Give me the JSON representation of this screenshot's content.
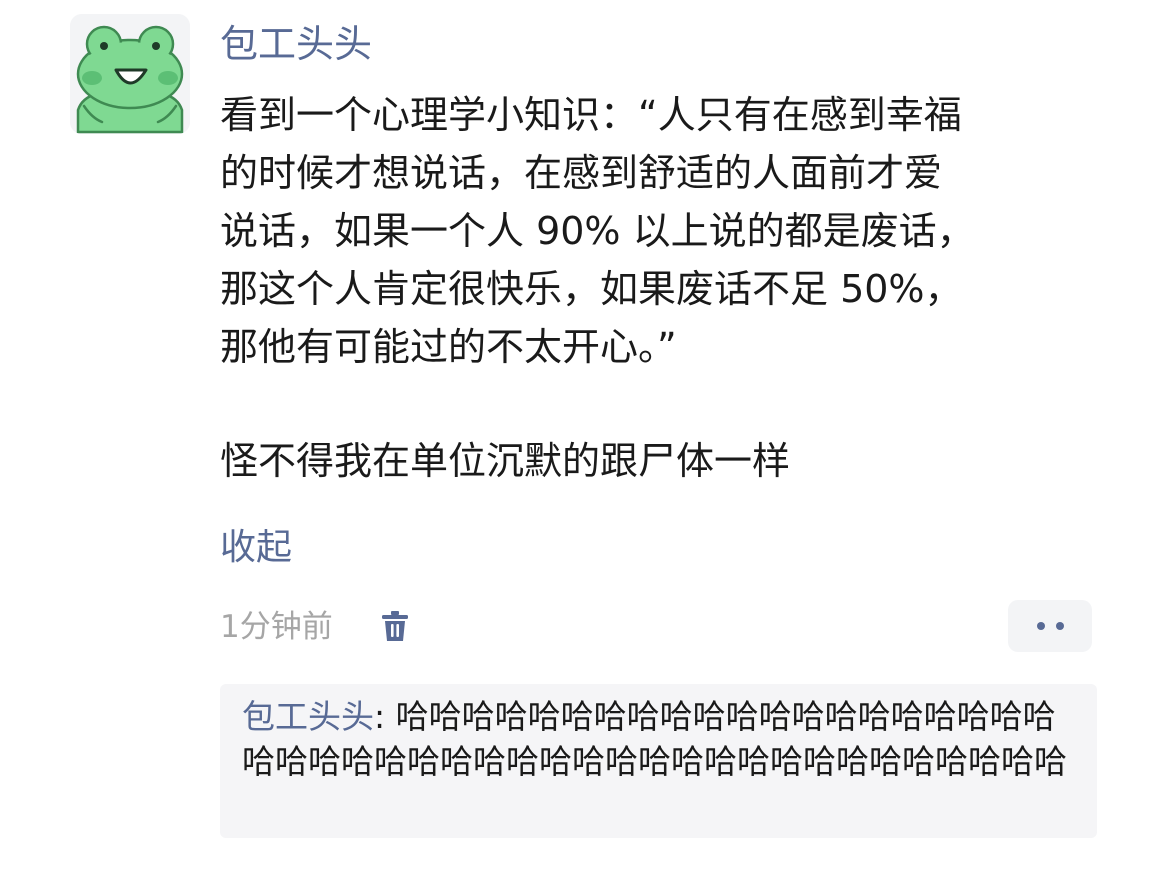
{
  "post": {
    "author": "包工头头",
    "lines": [
      "看到一个心理学小知识：“人只有在感到幸福",
      "的时候才想说话，在感到舒适的人面前才爱",
      "说话，如果一个人 90% 以上说的都是废话，",
      "那这个人肯定很快乐，如果废话不足 50%，",
      "那他有可能过的不太开心。”"
    ],
    "comment_line": "怪不得我在单位沉默的跟尸体一样",
    "collapse_label": "收起",
    "timestamp": "1分钟前"
  },
  "icons": {
    "avatar": "frog-avatar",
    "delete": "trash-icon",
    "more": "more-dots-icon"
  },
  "reply": {
    "author": "包工头头",
    "separator": ": ",
    "text": "哈哈哈哈哈哈哈哈哈哈哈哈哈哈哈哈哈哈哈哈哈哈哈哈哈哈哈哈哈哈哈哈哈哈哈哈哈哈哈哈哈哈哈哈哈"
  },
  "colors": {
    "link": "#586a95",
    "meta": "#a6a6a6",
    "text": "#1a1a1a",
    "reply_bg": "#f5f5f7",
    "frog_green": "#7fd992"
  }
}
